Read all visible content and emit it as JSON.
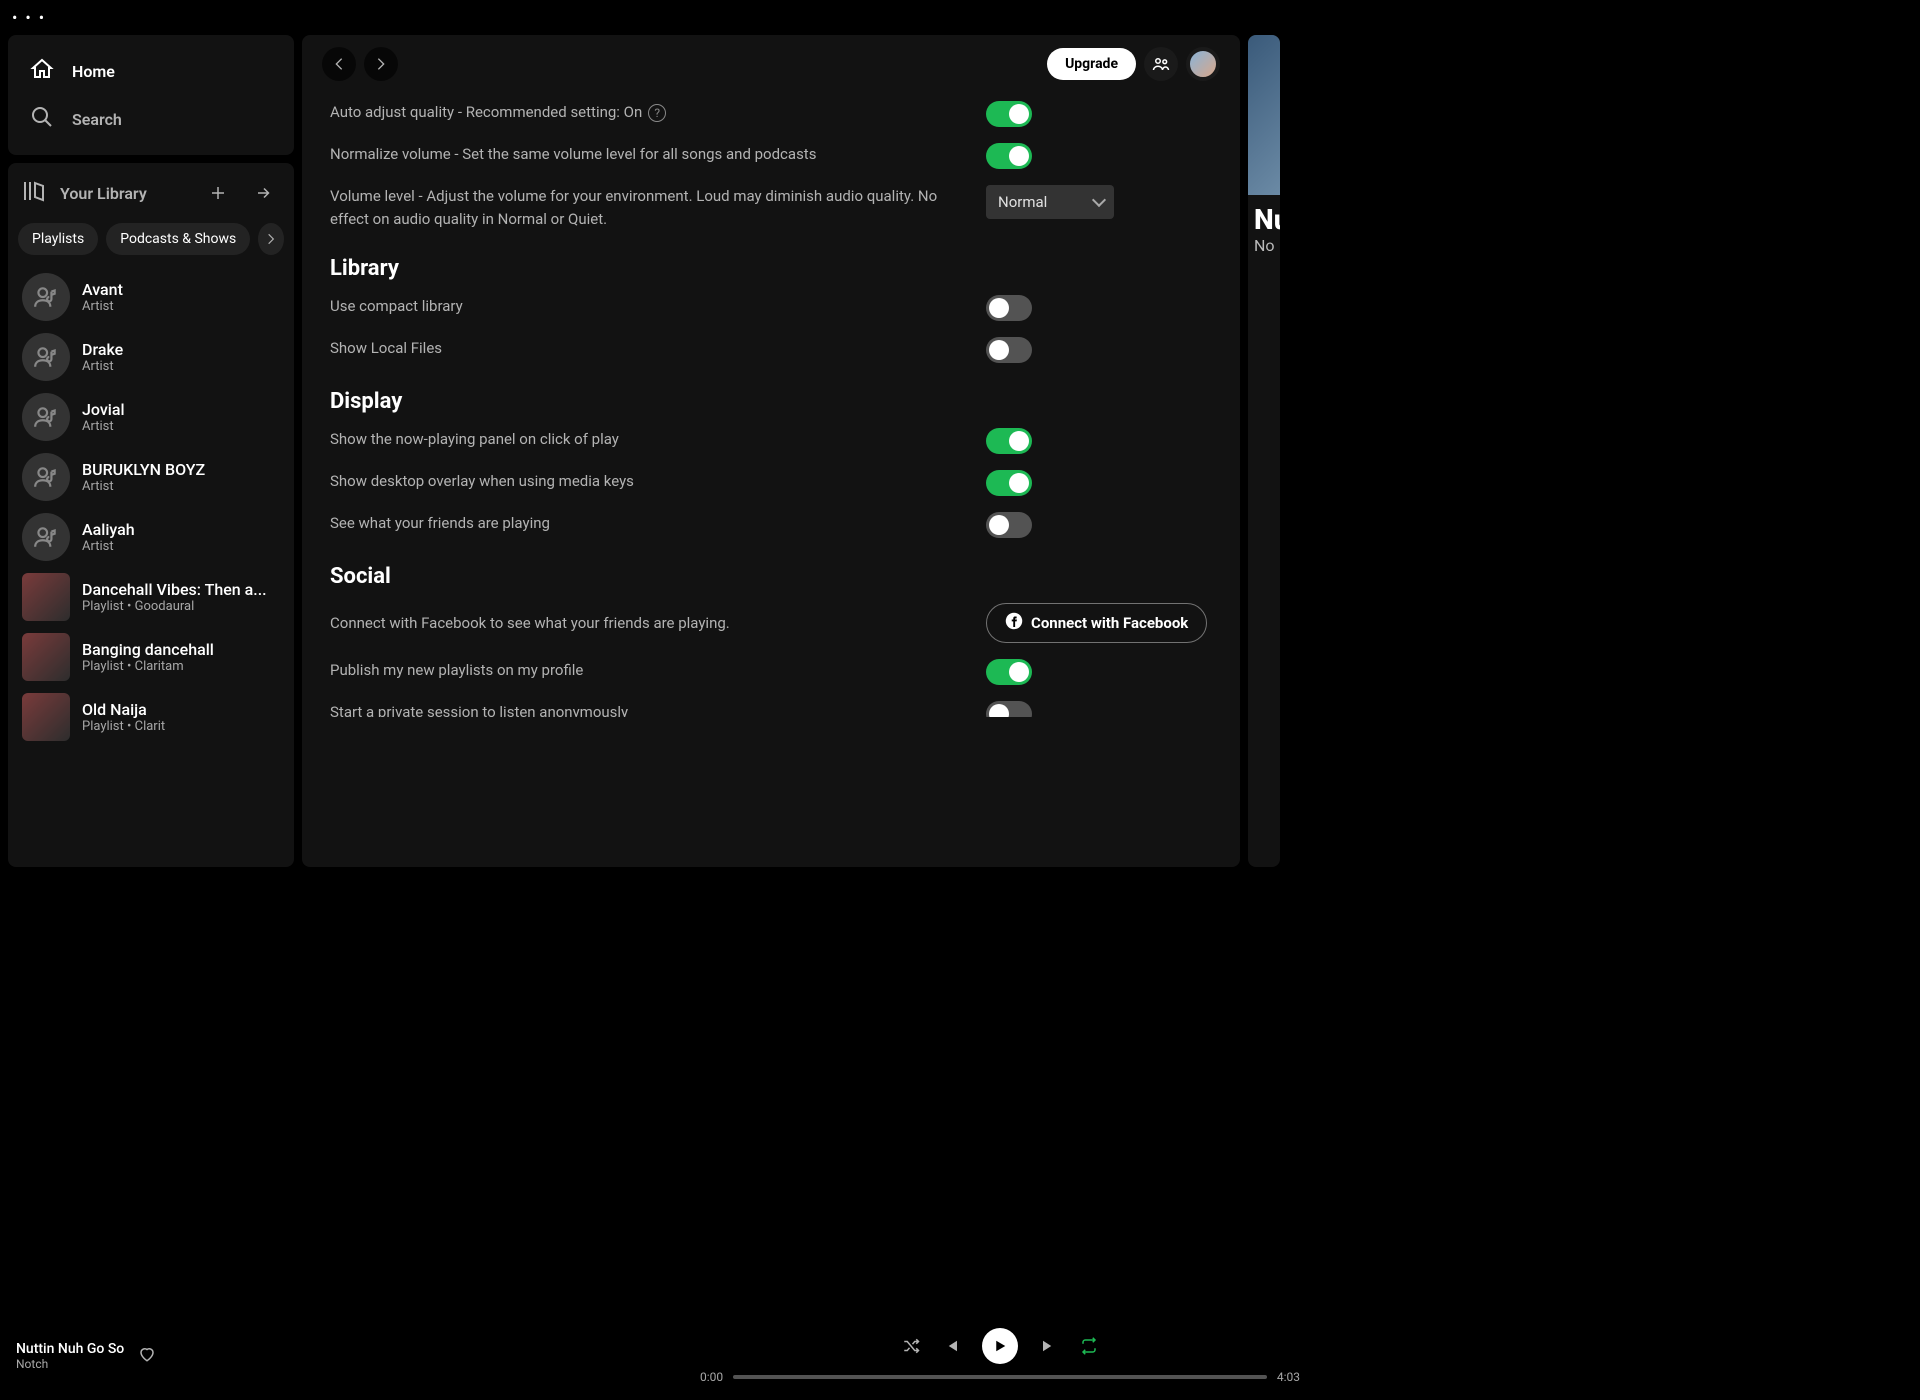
{
  "dots": "• • •",
  "nav": {
    "home": "Home",
    "search": "Search"
  },
  "library": {
    "title": "Your Library",
    "chips": [
      "Playlists",
      "Podcasts & Shows"
    ],
    "items": [
      {
        "name": "Avant",
        "sub": "Artist",
        "type": "artist"
      },
      {
        "name": "Drake",
        "sub": "Artist",
        "type": "artist"
      },
      {
        "name": "Jovial",
        "sub": "Artist",
        "type": "artist"
      },
      {
        "name": "BURUKLYN BOYZ",
        "sub": "Artist",
        "type": "artist"
      },
      {
        "name": "Aaliyah",
        "sub": "Artist",
        "type": "artist"
      },
      {
        "name": "Dancehall Vibes: Then a...",
        "sub": "Playlist • Goodaural",
        "type": "playlist"
      },
      {
        "name": "Banging dancehall",
        "sub": "Playlist • Claritam",
        "type": "playlist"
      },
      {
        "name": "Old Naija",
        "sub": "Playlist • Clarit",
        "type": "playlist"
      }
    ]
  },
  "topbar": {
    "upgrade": "Upgrade"
  },
  "settings": {
    "auto_adjust": "Auto adjust quality - Recommended setting: On",
    "normalize": "Normalize volume - Set the same volume level for all songs and podcasts",
    "volume_level": "Volume level - Adjust the volume for your environment. Loud may diminish audio quality. No effect on audio quality in Normal or Quiet.",
    "volume_select": "Normal",
    "library_h": "Library",
    "compact": "Use compact library",
    "local": "Show Local Files",
    "display_h": "Display",
    "nowplaying": "Show the now-playing panel on click of play",
    "overlay": "Show desktop overlay when using media keys",
    "friends": "See what your friends are playing",
    "social_h": "Social",
    "fb_desc": "Connect with Facebook to see what your friends are playing.",
    "fb_btn": "Connect with Facebook",
    "publish": "Publish my new playlists on my profile",
    "private": "Start a private session to listen anonymously",
    "toggles": {
      "auto_adjust": true,
      "normalize": true,
      "compact": false,
      "local": false,
      "nowplaying": true,
      "overlay": true,
      "friends": false,
      "publish": true,
      "private": false
    }
  },
  "rightpane": {
    "title": "Nu",
    "sub": "No"
  },
  "player": {
    "track": "Nuttin Nuh Go So",
    "artist": "Notch",
    "current": "0:00",
    "total": "4:03"
  }
}
